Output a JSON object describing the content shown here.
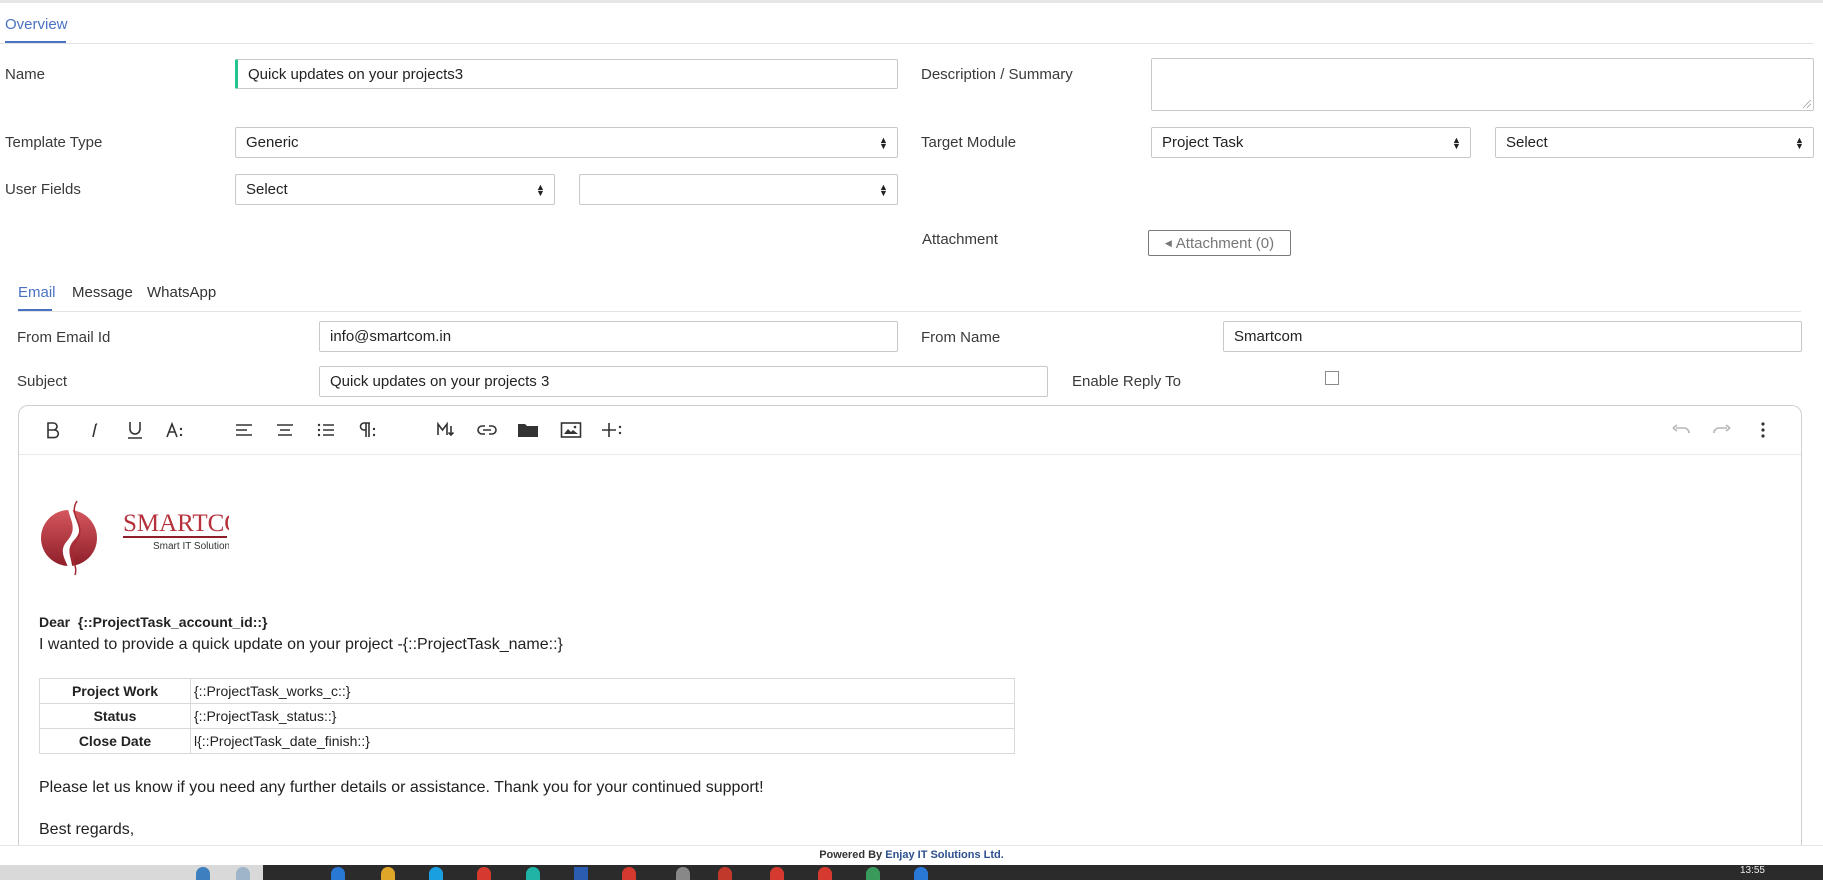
{
  "overview_tab": "Overview",
  "form": {
    "name_label": "Name",
    "name_value": "Quick updates on your projects3",
    "description_label": "Description / Summary",
    "description_value": "",
    "template_type_label": "Template Type",
    "template_type_value": "Generic",
    "target_module_label": "Target Module",
    "target_module_value": "Project Task",
    "target_module_field_value": "Select",
    "user_fields_label": "User Fields",
    "user_fields_value": "Select",
    "user_fields_second_value": "",
    "attachment_label": "Attachment",
    "attachment_button": "Attachment (0)"
  },
  "channel_tabs": [
    "Email",
    "Message",
    "WhatsApp"
  ],
  "email": {
    "from_email_label": "From Email Id",
    "from_email_value": "info@smartcom.in",
    "from_name_label": "From Name",
    "from_name_value": "Smartcom",
    "subject_label": "Subject",
    "subject_value": "Quick updates on your projects 3",
    "reply_to_label": "Enable Reply To",
    "reply_to_checked": false
  },
  "toolbar_icons": [
    "bold-icon",
    "italic-icon",
    "underline-icon",
    "font-size-icon",
    "align-left-icon",
    "align-center-icon",
    "list-icon",
    "paragraph-icon",
    "markdown-icon",
    "link-icon",
    "folder-icon",
    "image-icon",
    "insert-more-icon",
    "undo-icon",
    "redo-icon",
    "more-vertical-icon"
  ],
  "editor": {
    "logo_text": "SMARTCOM",
    "logo_tagline": "Smart IT Solutions",
    "dear": "Dear  {::ProjectTask_account_id::}",
    "intro": "I wanted to provide a quick update on your project -{::ProjectTask_name::}",
    "table": [
      {
        "key": "Project Work",
        "value": "{::ProjectTask_works_c::}"
      },
      {
        "key": "Status",
        "value": "{::ProjectTask_status::}"
      },
      {
        "key": "Close Date",
        "value": "l{::ProjectTask_date_finish::}"
      }
    ],
    "please": "Please let us know if you need any further details or assistance. Thank you for your continued support!",
    "regards": "Best regards,"
  },
  "footer": {
    "powered_by": "Powered By",
    "company": "Enjay IT Solutions Ltd."
  },
  "taskbar": {
    "clock": "13:55"
  },
  "colors": {
    "accent_blue": "#4a72c4",
    "name_accent": "#23c58d",
    "logo_red": "#b5323c"
  }
}
